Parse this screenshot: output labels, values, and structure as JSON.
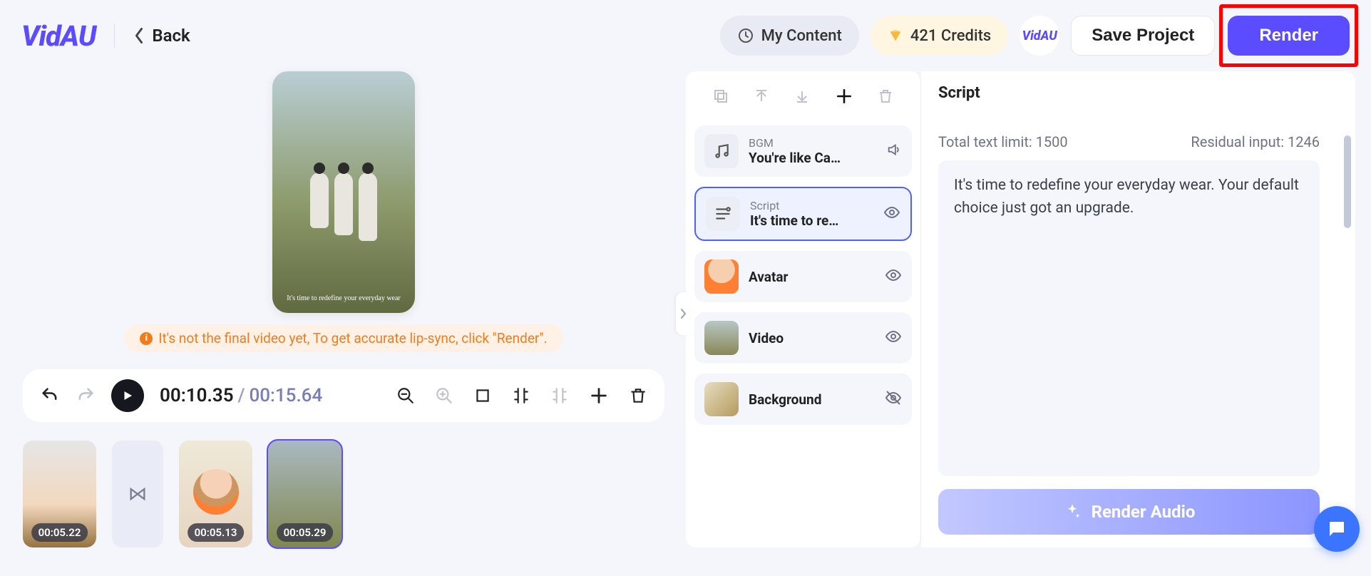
{
  "header": {
    "logo": "VidAU",
    "back": "Back",
    "my_content": "My Content",
    "credits": "421 Credits",
    "save": "Save Project",
    "render": "Render",
    "logo_badge": "VidAU"
  },
  "preview": {
    "caption": "It's time to redefine your everyday wear",
    "warning": "It's not the final video yet, To get accurate lip-sync, click \"Render\"."
  },
  "timeline": {
    "current": "00:10.35",
    "duration": "00:15.64",
    "clips": [
      {
        "time": "00:05.22"
      },
      {
        "time": "00:05.13"
      },
      {
        "time": "00:05.29"
      }
    ]
  },
  "layers": {
    "bgm": {
      "label": "BGM",
      "value": "You're like Ca…"
    },
    "script": {
      "label": "Script",
      "value": "It's time to re…"
    },
    "avatar": {
      "title": "Avatar"
    },
    "video": {
      "title": "Video"
    },
    "background": {
      "title": "Background"
    }
  },
  "script": {
    "header": "Script",
    "limit_label": "Total text limit: 1500",
    "residual_label": "Residual input: 1246",
    "text": "It's time to redefine your everyday wear. Your default choice just got an upgrade.",
    "render_audio": "Render Audio"
  }
}
